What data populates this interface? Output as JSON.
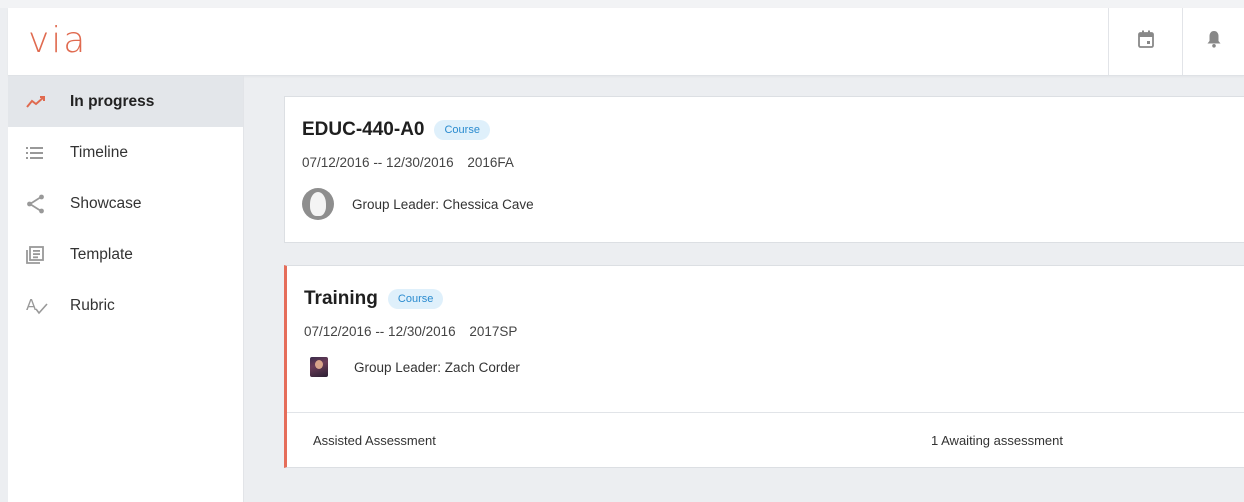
{
  "app": {
    "logo": "via"
  },
  "header": {
    "calendar_icon": "calendar-icon",
    "bell_icon": "bell-icon"
  },
  "sidebar": {
    "items": [
      {
        "label": "In progress",
        "icon": "trend-line-icon",
        "active": true
      },
      {
        "label": "Timeline",
        "icon": "list-icon",
        "active": false
      },
      {
        "label": "Showcase",
        "icon": "share-icon",
        "active": false
      },
      {
        "label": "Template",
        "icon": "template-icon",
        "active": false
      },
      {
        "label": "Rubric",
        "icon": "rubric-icon",
        "active": false
      }
    ]
  },
  "cards": [
    {
      "title": "EDUC-440-A0",
      "tag": "Course",
      "date_range": "07/12/2016 -- 12/30/2016",
      "term": "2016FA",
      "leader": "Group Leader: Chessica Cave"
    },
    {
      "title": "Training",
      "tag": "Course",
      "date_range": "07/12/2016 -- 12/30/2016",
      "term": "2017SP",
      "leader": "Group Leader: Zach Corder",
      "footer_left": "Assisted Assessment",
      "footer_right": "1 Awaiting assessment"
    }
  ],
  "colors": {
    "accent": "#e06a4f",
    "tag_bg": "#dff0fb",
    "tag_text": "#2a8bcf",
    "alert_border": "#e56d5a"
  }
}
